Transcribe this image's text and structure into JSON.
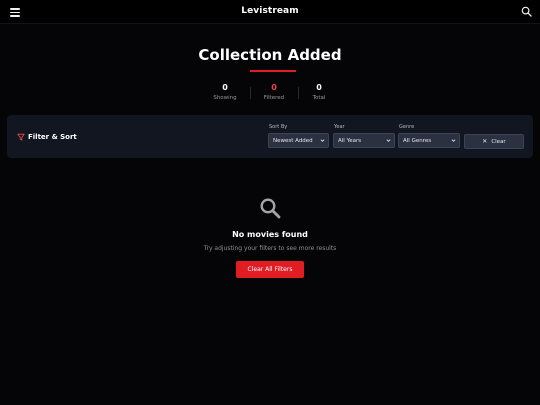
{
  "header": {
    "brand": "Levistream",
    "menu_icon": "hamburger-menu-icon",
    "search_icon": "search-icon"
  },
  "page": {
    "title": "Collection Added"
  },
  "stats": [
    {
      "value": "0",
      "label": "Showing"
    },
    {
      "value": "0",
      "label": "Filtered"
    },
    {
      "value": "0",
      "label": "Total"
    }
  ],
  "filters": {
    "title": "Filter & Sort",
    "icon": "filter-funnel-icon",
    "sort": {
      "label": "Sort By",
      "value": "Newest Added"
    },
    "year": {
      "label": "Year",
      "value": "All Years"
    },
    "genre": {
      "label": "Genre",
      "value": "All Genres"
    },
    "clear_label": "Clear"
  },
  "empty_state": {
    "icon": "magnifier-icon",
    "title": "No movies found",
    "subtitle": "Try adjusting your filters to see more results",
    "button_label": "Clear All Filters"
  },
  "colors": {
    "accent": "#e11d24",
    "background": "#050507",
    "panel": "#121620",
    "control": "#2b3140"
  }
}
